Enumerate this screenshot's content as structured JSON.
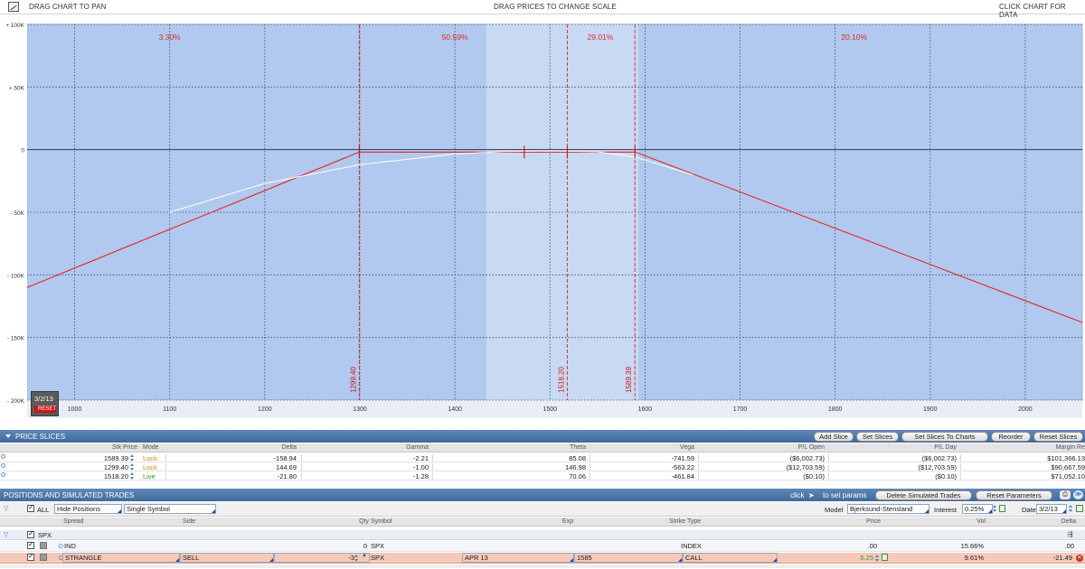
{
  "toolbar": {
    "icon": "chart-icon",
    "left_label": "DRAG CHART TO PAN",
    "center_label": "DRAG PRICES TO CHANGE SCALE",
    "right_label": "CLICK CHART FOR DATA"
  },
  "chart_data": {
    "type": "line",
    "x_ticks": [
      "1000",
      "1100",
      "1200",
      "1300",
      "1400",
      "1500",
      "1600",
      "1700",
      "1800",
      "1900",
      "2000"
    ],
    "y_ticks": [
      "+ 100K",
      "+ 50K",
      "0",
      "- 50K",
      "- 100K",
      "- 150K",
      "- 200K"
    ],
    "xlim": [
      950,
      2060
    ],
    "ylim": [
      -200000,
      100000
    ],
    "grid": true,
    "probability_labels": [
      {
        "x": 1100,
        "text": "3.30%"
      },
      {
        "x": 1400,
        "text": "50.59%"
      },
      {
        "x": 1553,
        "text": "29.01%"
      },
      {
        "x": 1820,
        "text": "20.10%"
      }
    ],
    "vertical_markers": [
      {
        "x": 1299.4,
        "label": "1299.40"
      },
      {
        "x": 1518.2,
        "label": "1518.20"
      },
      {
        "x": 1589.39,
        "label": "1589.39"
      }
    ],
    "highlight_range": [
      1433,
      1593
    ],
    "series": [
      {
        "color": "#e82424",
        "x": [
          950,
          1299.4,
          1590,
          2060
        ],
        "y": [
          -110000,
          -2000,
          -2000,
          -138000
        ]
      },
      {
        "color": "#ffffff",
        "x": [
          1100,
          1200,
          1300,
          1400,
          1450,
          1500,
          1550,
          1590,
          1650
        ],
        "y": [
          -50000,
          -27000,
          -12000,
          -3500,
          -1500,
          -1000,
          -1700,
          -6000,
          -20000
        ]
      }
    ]
  },
  "date_badge": {
    "date": "3/2/13",
    "tag": "RESET"
  },
  "price_slices": {
    "title": "PRICE SLICES",
    "buttons": [
      "Add Slice",
      "Set Slices",
      "Set Slices To Charts",
      "Reorder",
      "Reset Slices"
    ],
    "headers": [
      "Stk Price",
      "Mode",
      "Delta",
      "Gamma",
      "Theta",
      "Vega",
      "P/L Open",
      "P/L Day",
      "Margin Re"
    ],
    "rows": [
      {
        "price": "1589.39",
        "mode": "Lock",
        "mode_color": "#e08020",
        "delta": "-158.94",
        "gamma": "-2.21",
        "theta": "85.08",
        "vega": "-741.59",
        "pl_open": "($6,002.73)",
        "pl_day": "($6,002.73)",
        "margin": "$101,366.13"
      },
      {
        "price": "1299.40",
        "mode": "Lock",
        "mode_color": "#e08020",
        "delta": "144.69",
        "gamma": "-1.00",
        "theta": "146.98",
        "vega": "-563.22",
        "pl_open": "($12,703.59)",
        "pl_day": "($12,703.59)",
        "margin": "$90,667.59"
      },
      {
        "price": "1518.20",
        "mode": "Live",
        "mode_color": "#2f9a2f",
        "delta": "-21.80",
        "gamma": "-1.28",
        "theta": "70.06",
        "vega": "-461.84",
        "pl_open": "($0.10)",
        "pl_day": "($0.10)",
        "margin": "$71,052.10"
      }
    ]
  },
  "positions": {
    "title": "POSITIONS AND SIMULATED TRADES",
    "click_hint_prefix": "click",
    "click_hint_suffix": "to set params",
    "buttons": [
      "Delete Simulated Trades",
      "Reset Parameters"
    ],
    "all_label": "ALL",
    "hide_select": "Hide Positions",
    "symbol_select": "Single Symbol",
    "model_label": "Model",
    "model_value": "Bjerksund-Stensland",
    "interest_label": "Interest",
    "interest_value": "0.25%",
    "date_label": "Date",
    "date_value": "3/2/13",
    "headers": [
      "Spread",
      "Side",
      "Qty",
      "Symbol",
      "Exp",
      "Strike",
      "Type",
      "Price",
      "Vol",
      "Delta"
    ],
    "group": "SPX",
    "rows": [
      {
        "spread": "IND",
        "side": "",
        "qty": "0",
        "symbol": "SPX",
        "exp": "",
        "strike": "",
        "type": "INDEX",
        "price": ".00",
        "vol": "15.66%",
        "delta": ".00"
      },
      {
        "spread": "STRANGLE",
        "side": "SELL",
        "qty": "-3",
        "symbol": "SPX",
        "exp": "APR 13",
        "strike": "1585",
        "type": "CALL",
        "price": "5.25",
        "vol": "9.61%",
        "delta": "-21.49"
      }
    ]
  }
}
